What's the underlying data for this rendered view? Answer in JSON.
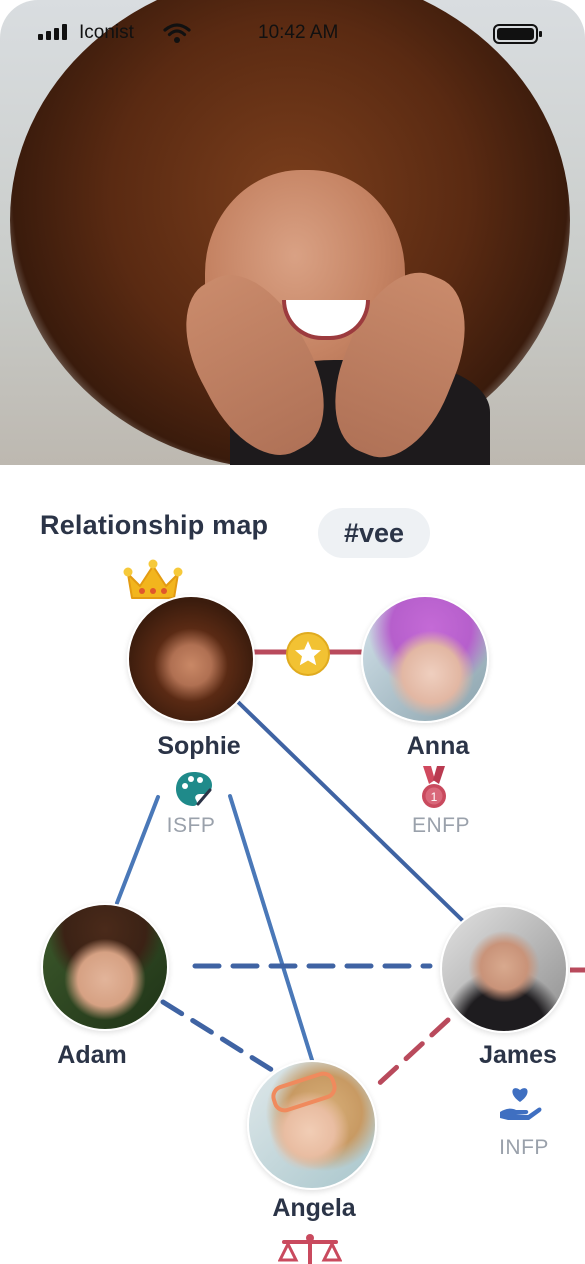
{
  "status_bar": {
    "carrier": "Iconist",
    "time": "10:42 AM"
  },
  "hero": {
    "image": "smiling-woman-curly-hair-photo"
  },
  "relationship_map": {
    "title": "Relationship map",
    "tag": "#vee",
    "people": [
      {
        "name": "Sophie",
        "mbti": "ISFP",
        "badge_icon": "palette-icon",
        "has_crown": true
      },
      {
        "name": "Anna",
        "mbti": "ENFP",
        "badge_icon": "medal-icon",
        "medal_number": "1"
      },
      {
        "name": "Adam"
      },
      {
        "name": "James",
        "mbti": "INFP",
        "badge_icon": "heart-hand-icon"
      },
      {
        "name": "Angela",
        "badge_icon": "scales-icon"
      }
    ]
  },
  "colors": {
    "title": "#2b3447",
    "blue_link": "#3f63a3",
    "red_link": "#b94a5c",
    "gold": "#f2c233",
    "teal": "#1f8a8a"
  }
}
